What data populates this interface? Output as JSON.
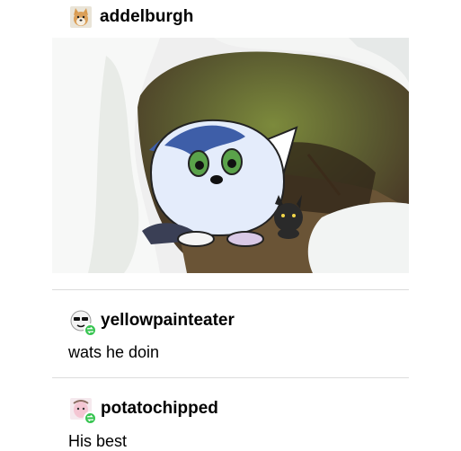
{
  "post": {
    "author": "addelburgh",
    "author_avatar_icon": "shiba-dog-avatar",
    "image_subject": "cartoon-wolf-in-snow-burrow"
  },
  "reblogs": [
    {
      "username": "yellowpainteater",
      "text": "wats he doin",
      "avatar_icon": "sunglasses-face-avatar",
      "badge_icon": "reblog-icon",
      "badge_color": "#39c552"
    },
    {
      "username": "potatochipped",
      "text": "His best",
      "avatar_icon": "pink-character-avatar",
      "badge_icon": "reblog-icon",
      "badge_color": "#39c552"
    }
  ]
}
